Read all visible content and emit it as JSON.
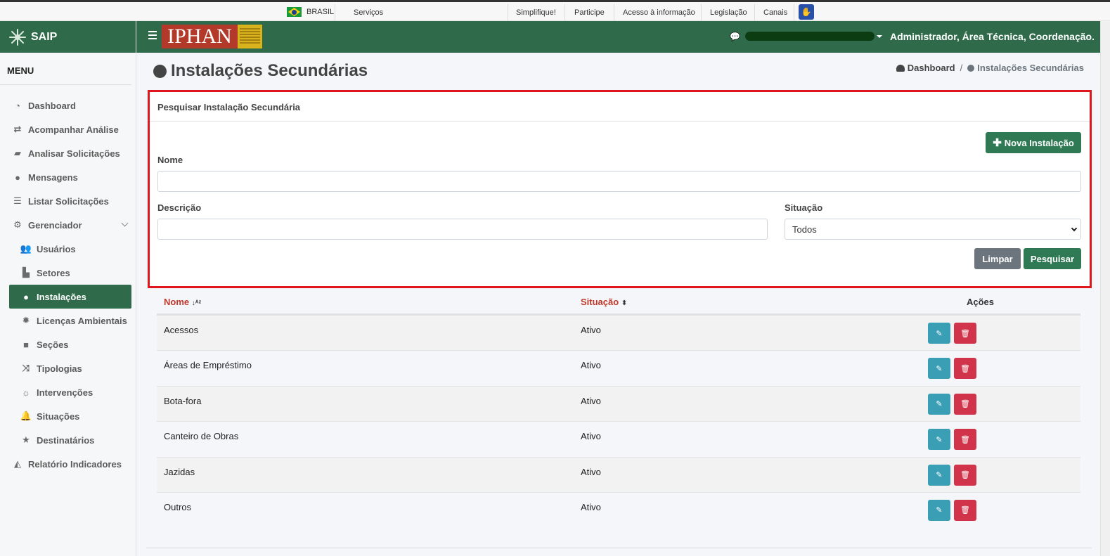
{
  "gov_bar": {
    "country": "BRASIL",
    "links": [
      "Serviços",
      "Simplifique!",
      "Participe",
      "Acesso à informação",
      "Legislação",
      "Canais"
    ]
  },
  "brand": {
    "name": "SAIP"
  },
  "menu": {
    "title": "MENU",
    "items": [
      {
        "label": "Dashboard",
        "icon": "dashboard-icon"
      },
      {
        "label": "Acompanhar Análise",
        "icon": "exchange-icon"
      },
      {
        "label": "Analisar Solicitações",
        "icon": "book-icon"
      },
      {
        "label": "Mensagens",
        "icon": "comments-icon"
      },
      {
        "label": "Listar Solicitações",
        "icon": "list-icon"
      },
      {
        "label": "Gerenciador",
        "icon": "cogs-icon"
      },
      {
        "label": "Usuários",
        "icon": "users-icon"
      },
      {
        "label": "Setores",
        "icon": "industry-icon"
      },
      {
        "label": "Instalações",
        "icon": "circle-icon"
      },
      {
        "label": "Licenças Ambientais",
        "icon": "certificate-icon"
      },
      {
        "label": "Seções",
        "icon": "square-icon"
      },
      {
        "label": "Tipologias",
        "icon": "random-icon"
      },
      {
        "label": "Intervenções",
        "icon": "sun-icon"
      },
      {
        "label": "Situações",
        "icon": "bell-icon"
      },
      {
        "label": "Destinatários",
        "icon": "star-icon"
      },
      {
        "label": "Relatório Indicadores",
        "icon": "area-chart-icon"
      }
    ]
  },
  "header": {
    "logo_text": "IPHAN",
    "user": "Administrador, Área Técnica, Coordenação..."
  },
  "page": {
    "title": "Instalações Secundárias",
    "breadcrumb": [
      "Dashboard",
      "Instalações Secundárias"
    ]
  },
  "search": {
    "title": "Pesquisar Instalação Secundária",
    "new_button": "Nova Instalação",
    "nome_label": "Nome",
    "nome_value": "",
    "descricao_label": "Descrição",
    "descricao_value": "",
    "situacao_label": "Situação",
    "situacao_value": "Todos",
    "clear_button": "Limpar",
    "search_button": "Pesquisar"
  },
  "table": {
    "headers": {
      "nome": "Nome",
      "situacao": "Situação",
      "acoes": "Ações"
    },
    "rows": [
      {
        "nome": "Acessos",
        "situacao": "Ativo"
      },
      {
        "nome": "Áreas de Empréstimo",
        "situacao": "Ativo"
      },
      {
        "nome": "Bota-fora",
        "situacao": "Ativo"
      },
      {
        "nome": "Canteiro de Obras",
        "situacao": "Ativo"
      },
      {
        "nome": "Jazidas",
        "situacao": "Ativo"
      },
      {
        "nome": "Outros",
        "situacao": "Ativo"
      }
    ]
  },
  "colors": {
    "primary_green": "#2f6b4a",
    "button_green": "#2f7a55",
    "edit_blue": "#3a9fb5",
    "delete_red": "#d1334b",
    "highlight_border": "#e0161e",
    "sort_header_red": "#c0392b"
  }
}
